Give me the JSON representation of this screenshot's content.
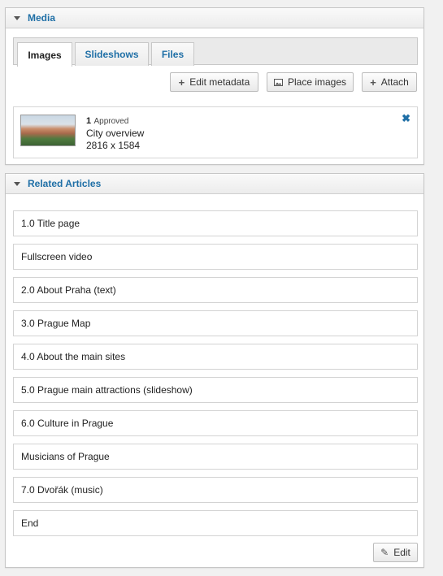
{
  "media": {
    "title": "Media",
    "tabs": [
      "Images",
      "Slideshows",
      "Files"
    ],
    "buttons": {
      "edit_metadata": "Edit metadata",
      "place_images": "Place images",
      "attach": "Attach"
    },
    "item": {
      "count": "1",
      "status": "Approved",
      "name": "City overview",
      "dimensions": "2816 x 1584"
    }
  },
  "related": {
    "title": "Related Articles",
    "articles": [
      "1.0 Title page",
      "Fullscreen video",
      "2.0 About Praha (text)",
      "3.0 Prague Map",
      "4.0 About the main sites",
      "5.0 Prague main attractions (slideshow)",
      "6.0 Culture in Prague",
      "Musicians of Prague",
      "7.0 Dvořák (music)",
      "End"
    ],
    "edit_label": "Edit"
  },
  "icons": {
    "collapse": "caret-down-icon",
    "add": "plus-icon",
    "image": "image-icon",
    "remove": "close-icon",
    "edit": "pencil-icon"
  },
  "colors": {
    "accent": "#1f6fa6",
    "panel_border": "#c6c6c6",
    "background": "#f1f1f1"
  }
}
